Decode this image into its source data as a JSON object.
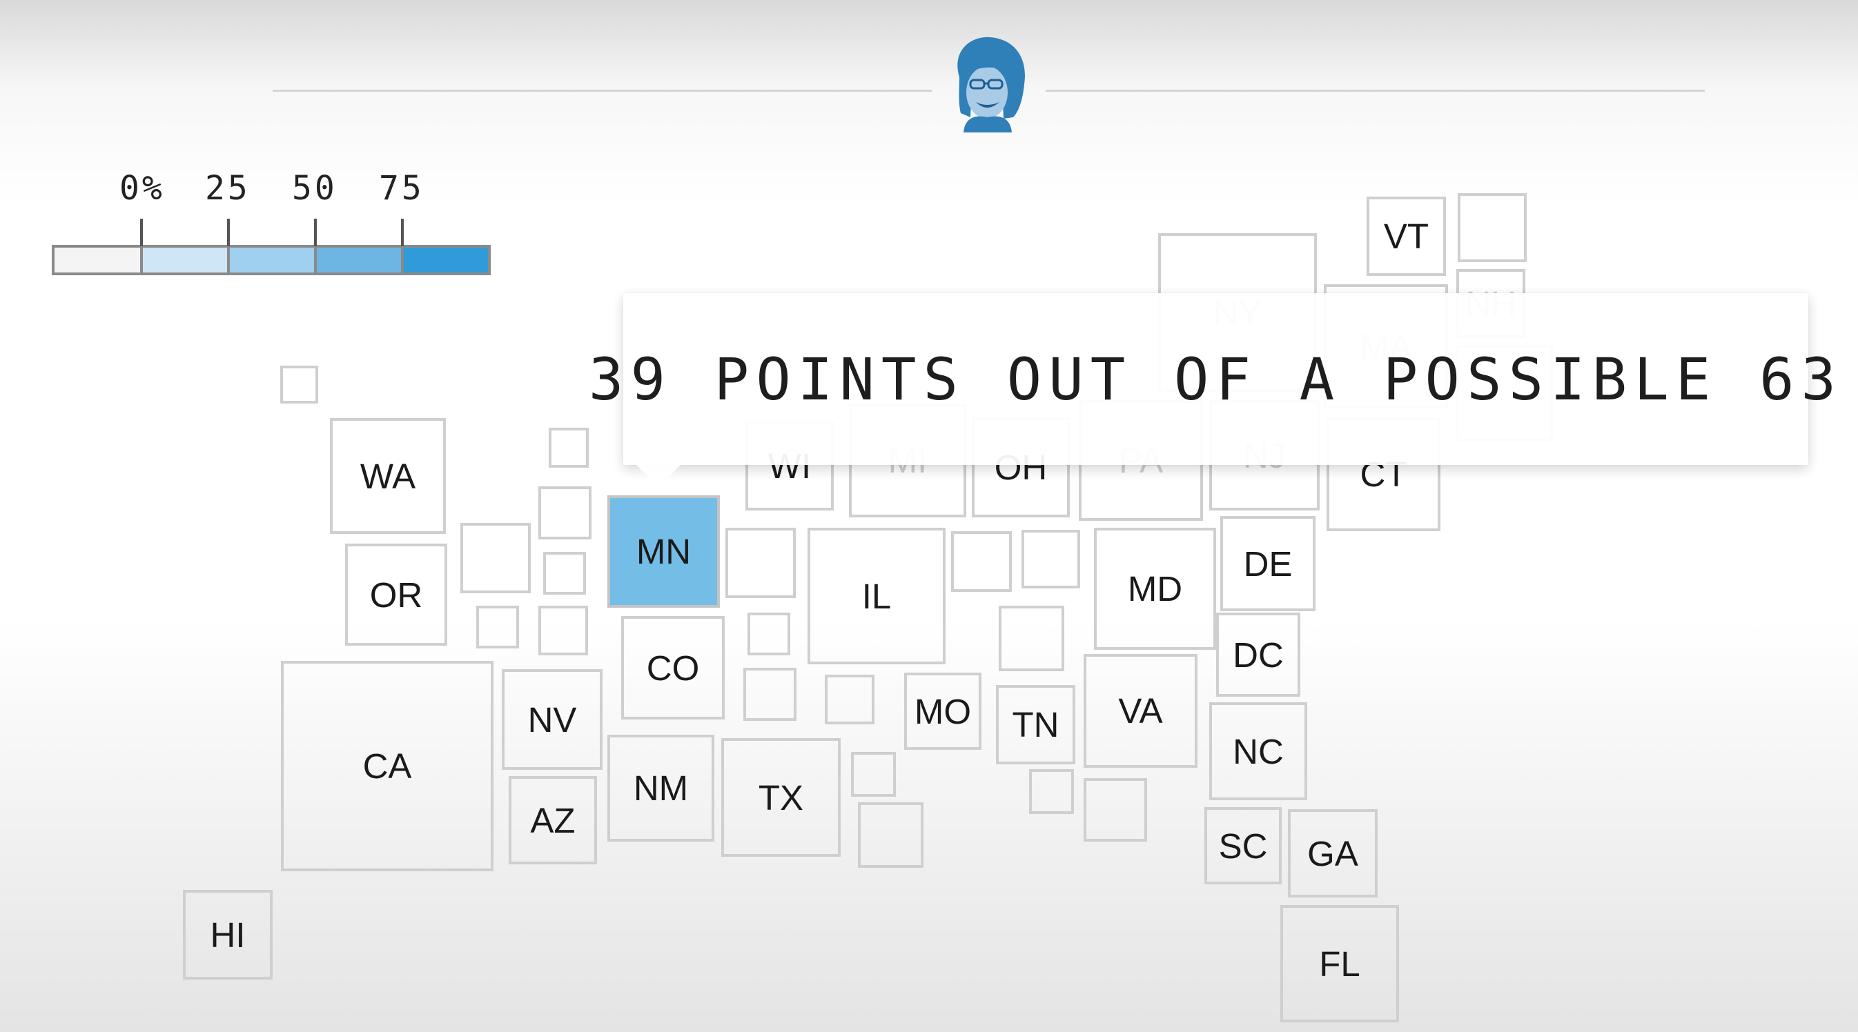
{
  "legend": {
    "labels": [
      "0%",
      "25",
      "50",
      "75"
    ],
    "colors": [
      "#f4f4f4",
      "#cfe6f6",
      "#9fd0ef",
      "#6db6e3",
      "#2f9bd8"
    ]
  },
  "candidate": {
    "avatar": "candidate-portrait",
    "tint": "#2f7fb8"
  },
  "tooltip": {
    "text": "39 POINTS OUT OF A POSSIBLE 63"
  },
  "highlight": {
    "state": "MN",
    "color": "#74bde6"
  },
  "states": {
    "VT": "VT",
    "NH": "NH",
    "NY": "NY",
    "MA": "MA",
    "WI": "WI",
    "MI": "MI",
    "OH": "OH",
    "PA": "PA",
    "NJ": "NJ",
    "CT": "CT",
    "WA": "WA",
    "MN": "MN",
    "OR": "OR",
    "IL": "IL",
    "MD": "MD",
    "DE": "DE",
    "DC": "DC",
    "CO": "CO",
    "NV": "NV",
    "MO": "MO",
    "TN": "TN",
    "VA": "VA",
    "CA": "CA",
    "NC": "NC",
    "NM": "NM",
    "TX": "TX",
    "AZ": "AZ",
    "SC": "SC",
    "GA": "GA",
    "HI": "HI",
    "FL": "FL"
  }
}
